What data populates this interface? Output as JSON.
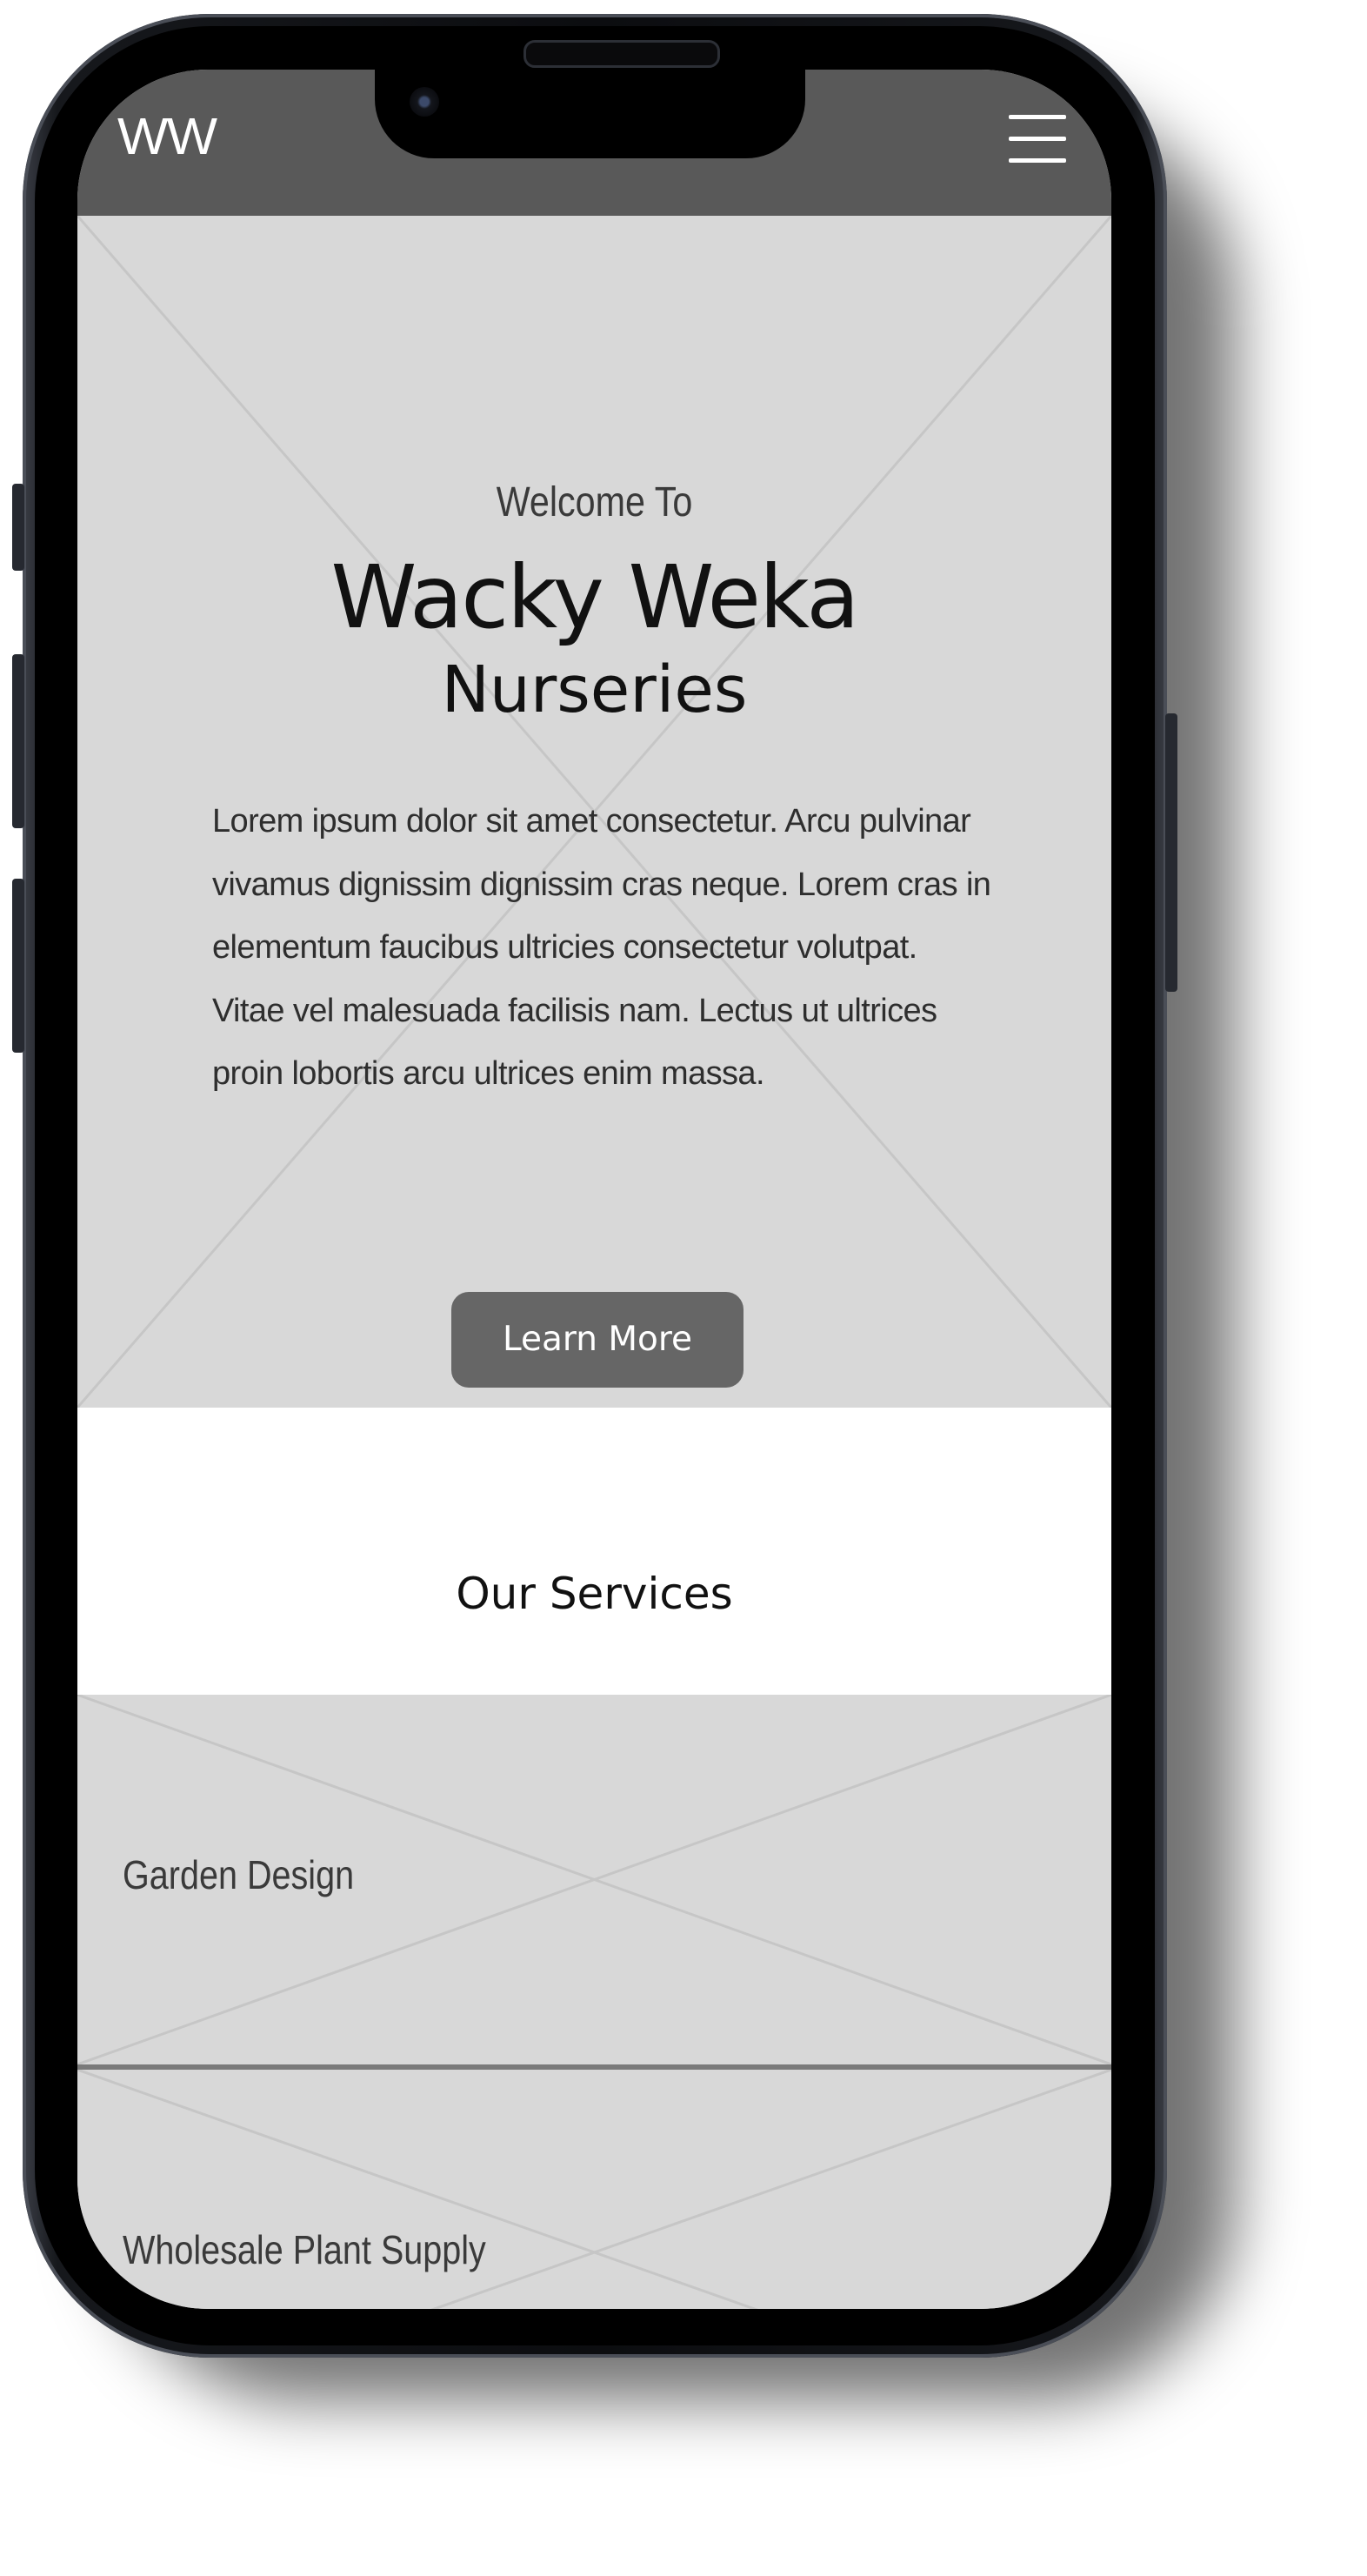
{
  "header": {
    "logo_text": "WW",
    "menu_icon": "hamburger-menu-icon"
  },
  "hero": {
    "welcome": "Welcome To",
    "title_line1": "Wacky Weka",
    "title_line2": "Nurseries",
    "body": "Lorem ipsum dolor sit amet consectetur. Arcu pulvinar vivamus dignissim dignissim cras neque. Lorem cras in elementum faucibus ultricies consectetur volutpat. Vitae vel malesuada facilisis nam. Lectus ut ultrices proin lobortis arcu ultrices enim massa.",
    "cta_label": "Learn More"
  },
  "services": {
    "heading": "Our Services",
    "items": [
      {
        "label": "Garden Design"
      },
      {
        "label": "Wholesale Plant Supply"
      }
    ]
  },
  "colors": {
    "header_bg": "#595959",
    "placeholder_bg": "#d8d8d8",
    "button_bg": "#666666",
    "divider": "#7a7a7a"
  }
}
